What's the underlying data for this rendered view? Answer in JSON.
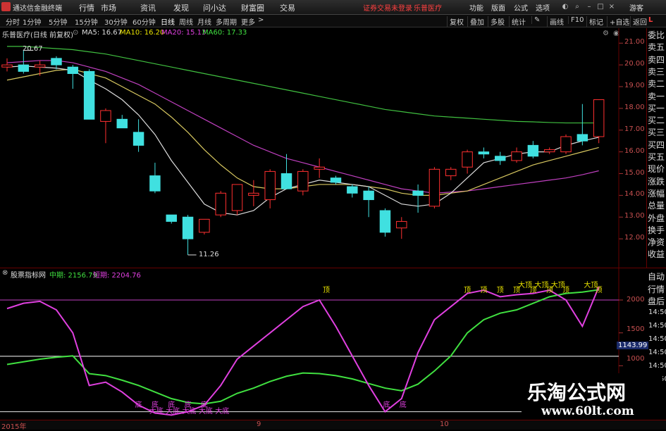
{
  "menubar": {
    "app_title": "通达信金融终端",
    "menus": [
      "行情",
      "市场",
      "资讯",
      "发现",
      "问小达",
      "财富圈",
      "交易"
    ],
    "notice": "证券交易未登录",
    "stock_tag": "乐普医疗",
    "right_menus": [
      "功能",
      "版面",
      "公式",
      "选项"
    ],
    "guest": "游客"
  },
  "periodbar": {
    "periods": [
      "分时",
      "1分钟",
      "5分钟",
      "15分钟",
      "30分钟",
      "60分钟",
      "日线",
      "周线",
      "月线",
      "多周期",
      "更多"
    ],
    "active": "日线",
    "tools": [
      "复权",
      "叠加",
      "多股",
      "统计",
      "画线",
      "F10",
      "标记",
      "+自选",
      "返回"
    ]
  },
  "main_info": {
    "stock": "乐普医疗(日线 前复权)",
    "ma5": "MA5: 16.67",
    "ma10": "MA10: 16.20",
    "ma20": "MA20: 15.13",
    "ma60": "MA60: 17.33",
    "high_label": "20.67",
    "low_label": "11.26",
    "axis_ticks": [
      "21.00",
      "20.00",
      "19.00",
      "18.00",
      "17.00",
      "16.00",
      "15.00",
      "14.00",
      "13.00",
      "12.00"
    ],
    "corner": "L"
  },
  "right_panel": {
    "items": [
      "委比",
      "卖五",
      "卖四",
      "卖三",
      "卖二",
      "卖一",
      "买一",
      "买二",
      "买三",
      "买四",
      "买五",
      "现价",
      "涨跌",
      "涨幅",
      "总量",
      "外盘",
      "换手",
      "净资",
      "收益"
    ],
    "sub_items": [
      "自动",
      "行情",
      "盘后"
    ],
    "sub_ticks": [
      "14:50",
      "14:50",
      "14:50",
      "14:50",
      "14:50",
      "14:50"
    ]
  },
  "indicator": {
    "name": "股票指标网",
    "mid_label": "中期: 2156.79",
    "short_label": "短期: 2204.76",
    "axis_ticks": [
      "2000",
      "1500",
      "1000"
    ],
    "current_value": "1143.99",
    "top_label": "顶",
    "top_labels_right": [
      "顶",
      "顶",
      "顶",
      "顶",
      "顶",
      "顶",
      "顶",
      "顶"
    ],
    "big_top_labels": [
      "大顶",
      "大顶",
      "大顶",
      "大顶"
    ],
    "bottom_label": "底",
    "big_bottom_label": "大底"
  },
  "dates": [
    "2015年",
    "9",
    "10"
  ],
  "watermark": {
    "cn": "乐淘公式网",
    "url": "www.60lt.com"
  },
  "chart_data": {
    "type": "candlestick",
    "ylim": [
      11,
      21.3
    ],
    "candles": [
      {
        "o": 19.9,
        "h": 20.3,
        "l": 19.7,
        "c": 20.0
      },
      {
        "o": 20.0,
        "h": 20.67,
        "l": 19.6,
        "c": 19.7
      },
      {
        "o": 19.9,
        "h": 20.2,
        "l": 19.5,
        "c": 20.0
      },
      {
        "o": 20.3,
        "h": 20.4,
        "l": 19.8,
        "c": 20.0
      },
      {
        "o": 19.9,
        "h": 20.0,
        "l": 18.9,
        "c": 19.6
      },
      {
        "o": 19.7,
        "h": 19.8,
        "l": 17.5,
        "c": 17.5
      },
      {
        "o": 17.4,
        "h": 18.0,
        "l": 16.4,
        "c": 17.9
      },
      {
        "o": 17.5,
        "h": 17.7,
        "l": 17.1,
        "c": 17.1
      },
      {
        "o": 16.9,
        "h": 17.5,
        "l": 16.0,
        "c": 16.3
      },
      {
        "o": 14.9,
        "h": 15.5,
        "l": 14.1,
        "c": 14.2
      },
      {
        "o": 13.1,
        "h": 13.1,
        "l": 12.7,
        "c": 12.8
      },
      {
        "o": 13.0,
        "h": 13.1,
        "l": 11.26,
        "c": 12.0
      },
      {
        "o": 12.3,
        "h": 12.9,
        "l": 12.2,
        "c": 12.9
      },
      {
        "o": 13.1,
        "h": 14.2,
        "l": 13.0,
        "c": 14.1
      },
      {
        "o": 13.3,
        "h": 14.4,
        "l": 13.1,
        "c": 14.5
      },
      {
        "o": 14.0,
        "h": 14.7,
        "l": 13.5,
        "c": 14.1
      },
      {
        "o": 13.8,
        "h": 15.2,
        "l": 13.4,
        "c": 15.1
      },
      {
        "o": 15.0,
        "h": 15.9,
        "l": 14.3,
        "c": 14.3
      },
      {
        "o": 14.2,
        "h": 15.2,
        "l": 14.0,
        "c": 15.1
      },
      {
        "o": 15.2,
        "h": 15.7,
        "l": 14.8,
        "c": 15.3
      },
      {
        "o": 14.8,
        "h": 14.9,
        "l": 14.5,
        "c": 14.6
      },
      {
        "o": 14.4,
        "h": 14.5,
        "l": 13.9,
        "c": 14.1
      },
      {
        "o": 14.2,
        "h": 14.4,
        "l": 13.0,
        "c": 13.8
      },
      {
        "o": 13.3,
        "h": 13.4,
        "l": 12.1,
        "c": 12.3
      },
      {
        "o": 12.5,
        "h": 13.0,
        "l": 12.0,
        "c": 12.8
      },
      {
        "o": 14.2,
        "h": 14.5,
        "l": 13.2,
        "c": 14.0
      },
      {
        "o": 13.5,
        "h": 15.3,
        "l": 13.4,
        "c": 15.2
      },
      {
        "o": 14.9,
        "h": 15.3,
        "l": 14.7,
        "c": 15.2
      },
      {
        "o": 15.3,
        "h": 16.1,
        "l": 15.0,
        "c": 16.0
      },
      {
        "o": 16.0,
        "h": 16.2,
        "l": 15.7,
        "c": 15.9
      },
      {
        "o": 15.8,
        "h": 16.0,
        "l": 15.4,
        "c": 15.6
      },
      {
        "o": 15.6,
        "h": 16.2,
        "l": 15.5,
        "c": 16.0
      },
      {
        "o": 16.3,
        "h": 16.5,
        "l": 15.7,
        "c": 15.8
      },
      {
        "o": 16.0,
        "h": 16.2,
        "l": 15.9,
        "c": 16.1
      },
      {
        "o": 16.0,
        "h": 16.8,
        "l": 15.9,
        "c": 16.7
      },
      {
        "o": 16.8,
        "h": 18.2,
        "l": 16.3,
        "c": 16.5
      },
      {
        "o": 16.7,
        "h": 18.4,
        "l": 16.4,
        "c": 18.4
      }
    ],
    "ma5": [
      19.9,
      19.95,
      19.9,
      19.85,
      19.75,
      19.3,
      18.9,
      18.4,
      17.7,
      16.8,
      15.6,
      14.6,
      13.6,
      13.2,
      13.1,
      13.3,
      13.9,
      14.3,
      14.5,
      14.7,
      14.6,
      14.5,
      14.4,
      14.0,
      13.6,
      13.5,
      13.6,
      14.1,
      14.8,
      15.5,
      15.7,
      15.9,
      16.0,
      16.0,
      16.3,
      16.5,
      16.67
    ],
    "ma10": [
      19.3,
      19.45,
      19.6,
      19.75,
      19.8,
      19.6,
      19.4,
      19.0,
      18.6,
      18.2,
      17.6,
      16.9,
      16.1,
      15.4,
      14.8,
      14.4,
      14.3,
      14.3,
      14.4,
      14.5,
      14.5,
      14.5,
      14.4,
      14.3,
      14.1,
      14.0,
      14.0,
      14.1,
      14.2,
      14.5,
      14.8,
      15.1,
      15.4,
      15.6,
      15.8,
      16.0,
      16.2
    ],
    "ma20": [
      20.1,
      20.15,
      20.2,
      20.2,
      20.1,
      19.9,
      19.7,
      19.4,
      19.1,
      18.7,
      18.3,
      17.9,
      17.5,
      17.1,
      16.7,
      16.3,
      16.0,
      15.7,
      15.5,
      15.3,
      15.1,
      14.9,
      14.7,
      14.5,
      14.3,
      14.2,
      14.1,
      14.15,
      14.2,
      14.3,
      14.4,
      14.5,
      14.6,
      14.7,
      14.8,
      14.95,
      15.13
    ],
    "ma60": [
      20.85,
      20.85,
      20.8,
      20.75,
      20.7,
      20.6,
      20.5,
      20.35,
      20.2,
      20.05,
      19.9,
      19.75,
      19.6,
      19.45,
      19.3,
      19.15,
      19.0,
      18.85,
      18.7,
      18.55,
      18.4,
      18.25,
      18.1,
      17.95,
      17.85,
      17.75,
      17.65,
      17.6,
      17.55,
      17.5,
      17.45,
      17.4,
      17.38,
      17.35,
      17.33,
      17.33,
      17.33
    ],
    "indicator_ylim": [
      200,
      2300
    ],
    "indicator_short": [
      1870,
      1950,
      1980,
      1850,
      1500,
      700,
      750,
      600,
      400,
      280,
      250,
      300,
      400,
      700,
      1100,
      1300,
      1500,
      1700,
      1900,
      2000,
      1600,
      1150,
      700,
      300,
      500,
      1200,
      1700,
      1900,
      2100,
      2150,
      2050,
      2080,
      2100,
      2150,
      2000,
      1600,
      2200
    ],
    "indicator_mid": [
      1020,
      1060,
      1100,
      1130,
      1150,
      880,
      850,
      780,
      700,
      600,
      500,
      440,
      420,
      460,
      580,
      660,
      760,
      840,
      890,
      880,
      850,
      800,
      730,
      660,
      620,
      720,
      920,
      1150,
      1500,
      1700,
      1800,
      1850,
      1950,
      2050,
      2100,
      2120,
      2156
    ]
  }
}
